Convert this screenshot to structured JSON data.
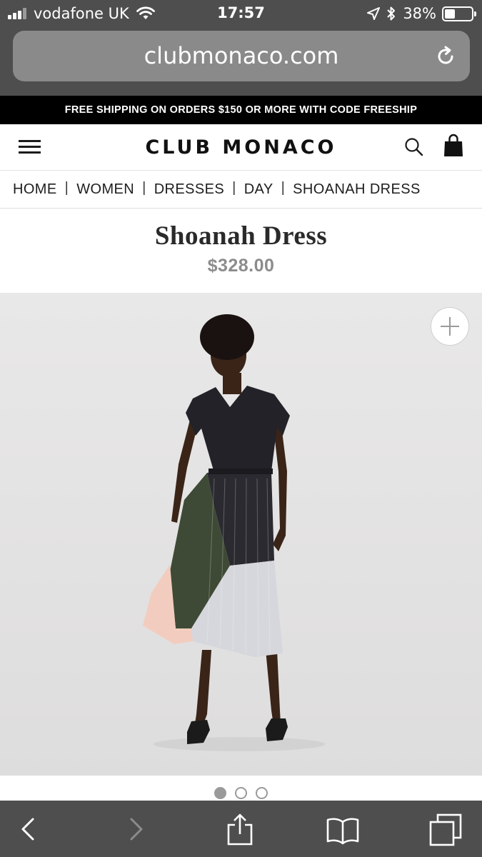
{
  "status_bar": {
    "carrier": "vodafone UK",
    "time": "17:57",
    "battery_percent": "38%",
    "battery_level": 0.38
  },
  "browser": {
    "url": "clubmonaco.com"
  },
  "promo": {
    "text": "FREE SHIPPING ON ORDERS $150 OR MORE WITH CODE ",
    "code": "FREESHIP"
  },
  "header": {
    "logo": "CLUB MONACO"
  },
  "breadcrumb": {
    "items": [
      "HOME",
      "WOMEN",
      "DRESSES",
      "DAY",
      "SHOANAH DRESS"
    ]
  },
  "product": {
    "title": "Shoanah Dress",
    "price": "$328.00"
  },
  "carousel": {
    "total": 3,
    "active": 1
  },
  "icons": {
    "menu": "hamburger-icon",
    "search": "search-icon",
    "bag": "shopping-bag-icon",
    "zoom": "plus-icon",
    "reload": "reload-icon",
    "back": "chevron-left-icon",
    "forward": "chevron-right-icon",
    "share": "share-icon",
    "bookmarks": "book-icon",
    "tabs": "tabs-icon"
  },
  "colors": {
    "browser_chrome": "#4e4e4e",
    "promo_bg": "#000000",
    "price_gray": "#8c8c8c"
  }
}
